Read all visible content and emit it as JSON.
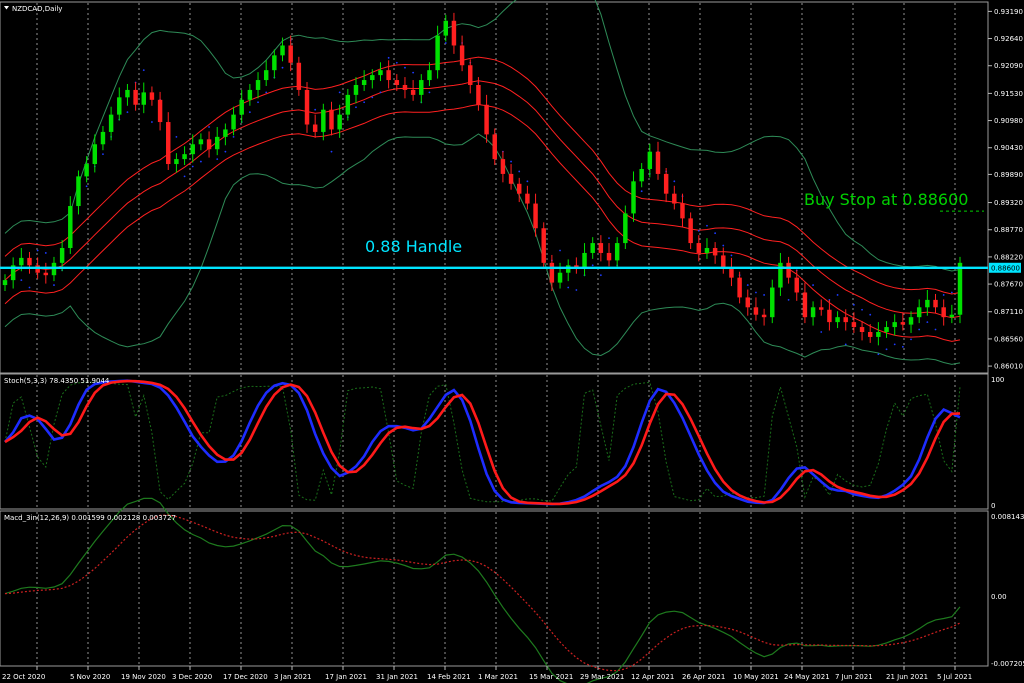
{
  "chart_data": {
    "type": "candlestick",
    "symbol_label": "NZDCAD,Daily",
    "x_tick_labels": [
      "22 Oct 2020",
      "5 Nov 2020",
      "19 Nov 2020",
      "3 Dec 2020",
      "17 Dec 2020",
      "3 Jan 2021",
      "17 Jan 2021",
      "31 Jan 2021",
      "14 Feb 2021",
      "1 Mar 2021",
      "15 Mar 2021",
      "29 Mar 2021",
      "12 Apr 2021",
      "26 Apr 2021",
      "10 May 2021",
      "24 May 2021",
      "7 Jun 2021",
      "21 Jun 2021",
      "5 Jul 2021"
    ],
    "price_axis": {
      "ticks": [
        0.9319,
        0.9264,
        0.9209,
        0.9153,
        0.9098,
        0.9043,
        0.8989,
        0.8932,
        0.8877,
        0.8822,
        0.8767,
        0.8711,
        0.8656,
        0.8601
      ],
      "tick_labels": [
        "0.93190",
        "0.92640",
        "0.92090",
        "0.91530",
        "0.90980",
        "0.90430",
        "0.89890",
        "0.89320",
        "0.88770",
        "0.88220",
        "0.87670",
        "0.87110",
        "0.86560",
        "0.86010"
      ],
      "range": [
        0.8587,
        0.9338
      ],
      "current_price_label": "0.88600"
    },
    "closes": [
      0.8775,
      0.8805,
      0.882,
      0.8805,
      0.879,
      0.8785,
      0.881,
      0.884,
      0.8925,
      0.8985,
      0.901,
      0.905,
      0.9075,
      0.911,
      0.9145,
      0.916,
      0.913,
      0.9155,
      0.914,
      0.9095,
      0.901,
      0.902,
      0.903,
      0.905,
      0.906,
      0.904,
      0.9065,
      0.908,
      0.911,
      0.914,
      0.916,
      0.918,
      0.92,
      0.923,
      0.925,
      0.9215,
      0.916,
      0.909,
      0.9075,
      0.912,
      0.908,
      0.911,
      0.915,
      0.917,
      0.918,
      0.919,
      0.92,
      0.918,
      0.917,
      0.916,
      0.915,
      0.918,
      0.92,
      0.927,
      0.93,
      0.925,
      0.921,
      0.917,
      0.913,
      0.907,
      0.902,
      0.899,
      0.897,
      0.895,
      0.893,
      0.888,
      0.881,
      0.877,
      0.879,
      0.8805,
      0.88,
      0.883,
      0.885,
      0.883,
      0.8815,
      0.885,
      0.891,
      0.8975,
      0.9,
      0.9035,
      0.899,
      0.895,
      0.893,
      0.89,
      0.885,
      0.883,
      0.884,
      0.8825,
      0.88,
      0.878,
      0.874,
      0.872,
      0.8705,
      0.87,
      0.876,
      0.881,
      0.878,
      0.875,
      0.87,
      0.872,
      0.8715,
      0.869,
      0.87,
      0.869,
      0.868,
      0.867,
      0.866,
      0.867,
      0.868,
      0.869,
      0.8685,
      0.87,
      0.872,
      0.8735,
      0.872,
      0.87,
      0.8705,
      0.881
    ],
    "overlays": [
      "Bollinger Bands (green)",
      "Envelope / moving average bands (red)",
      "Parabolic SAR (blue dots)"
    ],
    "buy_stop_price": 0.886,
    "handle_price": 0.88
  },
  "annotations": {
    "handle_text": "0.88 Handle",
    "buy_stop_text": "Buy Stop at 0.88600"
  },
  "stoch_panel": {
    "label": "Stoch(5,3,3) 78.4350 51.9044",
    "axis_labels": [
      "100",
      "0"
    ],
    "range": [
      0,
      100
    ]
  },
  "macd_panel": {
    "label": "Macd_3in(12,26,9) 0.001599 0.002128 0.003727",
    "axis_labels": [
      "0.008143",
      "0.00",
      "-0.007205"
    ],
    "range": [
      -0.007205,
      0.008143
    ]
  },
  "colors": {
    "bull": "#00e000",
    "bear": "#ff2020",
    "bollinger": "#2e8b57",
    "envelope": "#ff2020",
    "sar": "#1e3cff",
    "handle_line": "#00e5ff",
    "buy_stop_text": "#00d000",
    "stoch_main": "#1e2cff",
    "stoch_signal": "#ff1a1a",
    "macd_line": "#1e7a1e",
    "macd_signal": "#cc2020"
  }
}
